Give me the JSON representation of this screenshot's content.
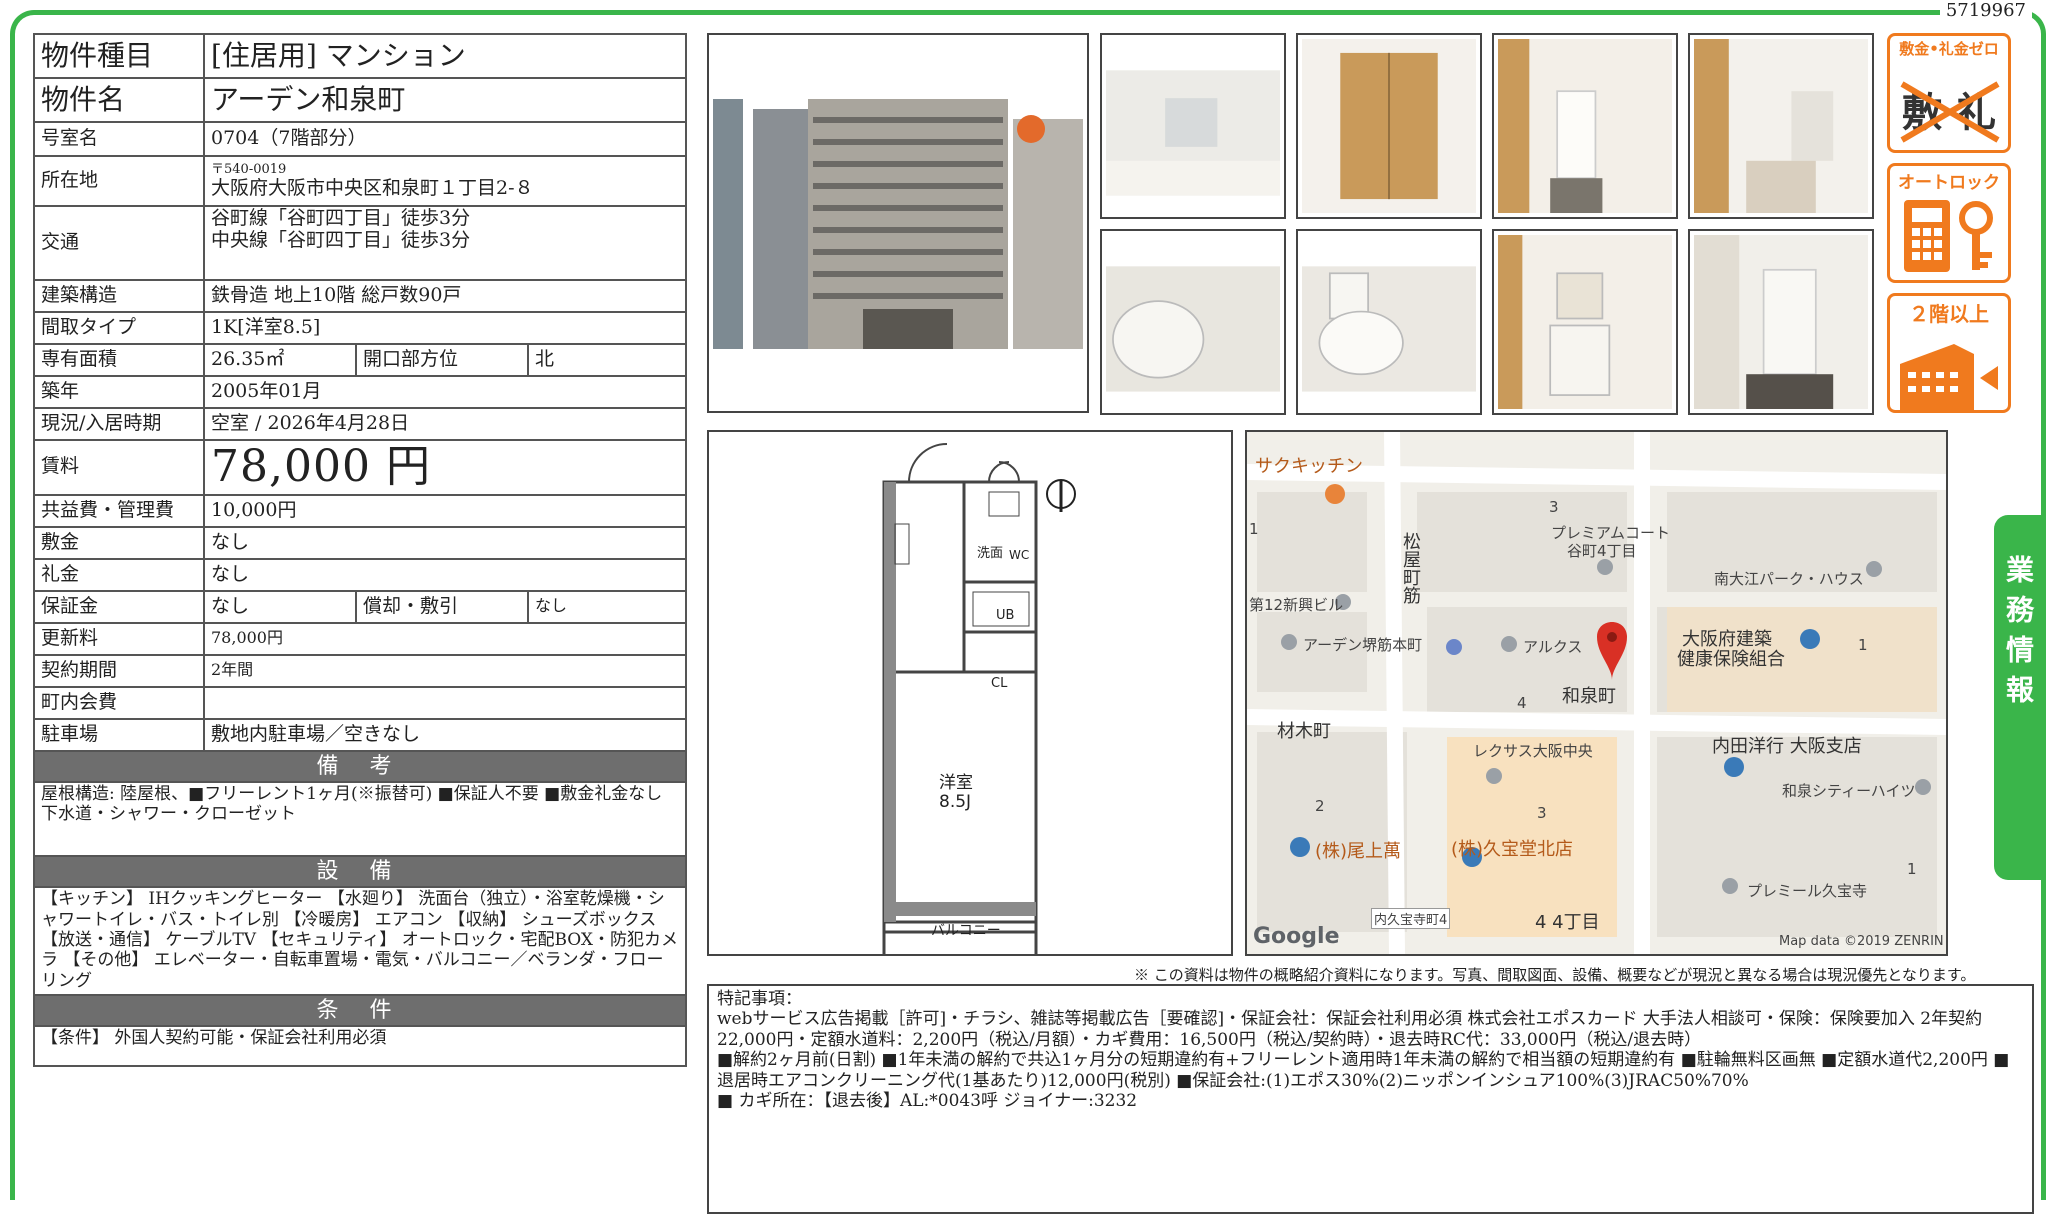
{
  "document_id": "5719967",
  "specs": {
    "type_label": "物件種目",
    "type_value": "[住居用] マンション",
    "name_label": "物件名",
    "name_value": "アーデン和泉町",
    "room_label": "号室名",
    "room_value": "0704（7階部分）",
    "address_label": "所在地",
    "postal": "〒540-0019",
    "address_value": "大阪府大阪市中央区和泉町１丁目2-８",
    "transit_label": "交通",
    "transit_line1": "谷町線「谷町四丁目」徒歩3分",
    "transit_line2": "中央線「谷町四丁目」徒歩3分",
    "structure_label": "建築構造",
    "structure_value": "鉄骨造 地上10階 総戸数90戸",
    "layout_label": "間取タイプ",
    "layout_value": "1K[洋室8.5]",
    "area_label": "専有面積",
    "area_value": "26.35㎡",
    "direction_label": "開口部方位",
    "direction_value": "北",
    "built_label": "築年",
    "built_value": "2005年01月",
    "status_label": "現況/入居時期",
    "status_value": "空室 / 2026年4月28日",
    "rent_label": "賃料",
    "rent_value": "78,000 円",
    "fee_label": "共益費・管理費",
    "fee_value": "10,000円",
    "deposit_label": "敷金",
    "deposit_value": "なし",
    "keymoney_label": "礼金",
    "keymoney_value": "なし",
    "guarantee_label": "保証金",
    "guarantee_value": "なし",
    "amort_label": "償却・敷引",
    "amort_value": "なし",
    "renewal_label": "更新料",
    "renewal_value": "78,000円",
    "contract_label": "契約期間",
    "contract_value": "2年間",
    "community_label": "町内会費",
    "community_value": "",
    "parking_label": "駐車場",
    "parking_value": "敷地内駐車場／空きなし"
  },
  "bikou": {
    "title": "備 考",
    "text": "屋根構造: 陸屋根、■フリーレント1ヶ月(※振替可) ■保証人不要 ■敷金礼金なし\n下水道・シャワー・クローゼット"
  },
  "setsubi": {
    "title": "設 備",
    "text": "【キッチン】 IHクッキングヒーター 【水廻り】 洗面台（独立）・浴室乾燥機・シャワートイレ・バス・トイレ別 【冷暖房】 エアコン 【収納】 シューズボックス 【放送・通信】 ケーブルTV 【セキュリティ】 オートロック・宅配BOX・防犯カメラ 【その他】 エレベーター・自転車置場・電気・バルコニー／ベランダ・フローリング"
  },
  "jouken": {
    "title": "条 件",
    "text": "【条件】 外国人契約可能・保証会社利用必須"
  },
  "badges": {
    "zero": "敷金•礼金ゼロ",
    "zero_chars": "敷 礼",
    "autolock": "オートロック",
    "floor2": "２階以上"
  },
  "floorplan": {
    "room": "洋室",
    "size": "8.5J",
    "balcony": "バルコニー",
    "wash": "洗面",
    "wc": "WC",
    "ub": "UB",
    "cl": "CL"
  },
  "map": {
    "labels": {
      "saku": "サクキッチン",
      "premium": "プレミアムコート",
      "premium2": "谷町4丁目",
      "matsuya": "松屋町筋",
      "minami": "南大江パーク・ハウス",
      "shinko": "第12新興ビル",
      "arden": "アーデン堺筋本町",
      "aruku": "アルクス",
      "izumi": "和泉町",
      "kenpo1": "大阪府建築",
      "kenpo2": "健康保険組合",
      "zaimoku": "材木町",
      "rexus": "レクサス大阪中央",
      "uchida": "内田洋行 大阪支店",
      "izumicity": "和泉シティーハイツ",
      "ogami": "(株)尾上萬",
      "kyuhodo": "(株)久宝堂北店",
      "premier": "プレミール久宝寺",
      "uchikyu": "内久宝寺町4",
      "chome4": "4 4丁目",
      "n1": "1",
      "n3": "3",
      "n4": "4",
      "n2": "2",
      "n3b": "3",
      "n1b": "1",
      "n1c": "1",
      "google": "Google",
      "copyright": "Map data ©2019 ZENRIN"
    }
  },
  "disclaimer": "※ この資料は物件の概略紹介資料になります。写真、間取図面、設備、概要などが現況と異なる場合は現況優先となります。",
  "remarks": {
    "title": "特記事項：",
    "line1": "webサービス広告掲載［許可]・チラシ、雑誌等掲載広告［要確認]・保証会社：保証会社利用必須 株式会社エポスカード 大手法人相談可・保険：保険要加入 2年契約 22,000円・定額水道料：2,200円（税込/月額）・カギ費用：16,500円（税込/契約時）・退去時RC代：33,000円（税込/退去時）",
    "line2": "■解約2ヶ月前(日割) ■1年未満の解約で共込1ヶ月分の短期違約有+フリーレント適用時1年未満の解約で相当額の短期違約有 ■駐輪無料区画無 ■定額水道代2,200円 ■退居時エアコンクリーニング代(1基あたり)12,000円(税別) ■保証会社:(1)エポス30%(2)ニッポンインシュア100%(3)JRAC50%70%",
    "line3": "■ カギ所在：【退去後】AL:*0043呼 ジョイナー:3232"
  },
  "sidetab": "業務情報",
  "colors": {
    "frame": "#3ab54a",
    "badge": "#f07a1e",
    "section": "#6e6e6e"
  }
}
